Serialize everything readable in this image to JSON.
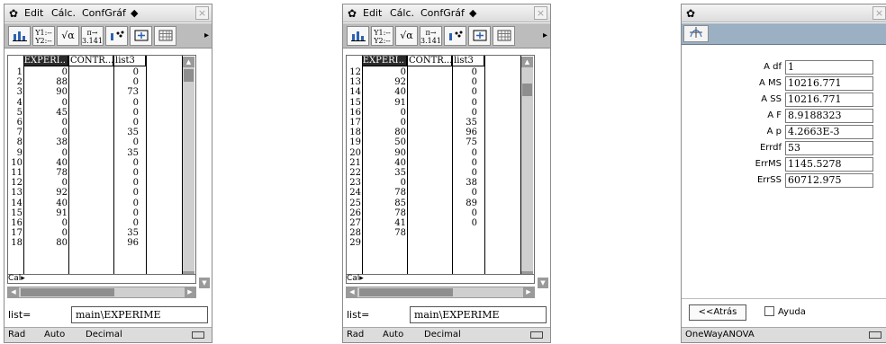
{
  "list_screens": [
    {
      "menu": {
        "items": [
          "Edit",
          "Cálc.",
          "ConfGráf",
          "◆"
        ],
        "close": "×"
      },
      "toolbar": {
        "b2": "Y1:--\nY2:--",
        "b3": "√α",
        "b4": "π→\n3.141..",
        "arrow": "▸"
      },
      "columns": [
        "EXPERI..",
        "CONTR...",
        "list3"
      ],
      "rows": [
        [
          "1",
          "0",
          "0"
        ],
        [
          "2",
          "88",
          "0"
        ],
        [
          "3",
          "90",
          "73"
        ],
        [
          "4",
          "0",
          "0"
        ],
        [
          "5",
          "45",
          "0"
        ],
        [
          "6",
          "0",
          "0"
        ],
        [
          "7",
          "0",
          "35"
        ],
        [
          "8",
          "38",
          "0"
        ],
        [
          "9",
          "0",
          "35"
        ],
        [
          "10",
          "40",
          "0"
        ],
        [
          "11",
          "78",
          "0"
        ],
        [
          "12",
          "0",
          "0"
        ],
        [
          "13",
          "92",
          "0"
        ],
        [
          "14",
          "40",
          "0"
        ],
        [
          "15",
          "91",
          "0"
        ],
        [
          "16",
          "0",
          "0"
        ],
        [
          "17",
          "0",
          "35"
        ],
        [
          "18",
          "80",
          "96"
        ]
      ],
      "cal_label": "Cal▸",
      "list_label": "list=",
      "list_value": "main\\EXPERIME",
      "status": {
        "angle": "Rad",
        "mode": "Auto",
        "format": "Decimal"
      }
    },
    {
      "menu": {
        "items": [
          "Edit",
          "Cálc.",
          "ConfGráf",
          "◆"
        ],
        "close": "×"
      },
      "toolbar": {
        "b2": "Y1:--\nY2:--",
        "b3": "√α",
        "b4": "π→\n3.141..",
        "arrow": "▸"
      },
      "columns": [
        "EXPERI..",
        "CONTR...",
        "list3"
      ],
      "rows": [
        [
          "12",
          "0",
          "0"
        ],
        [
          "13",
          "92",
          "0"
        ],
        [
          "14",
          "40",
          "0"
        ],
        [
          "15",
          "91",
          "0"
        ],
        [
          "16",
          "0",
          "0"
        ],
        [
          "17",
          "0",
          "35"
        ],
        [
          "18",
          "80",
          "96"
        ],
        [
          "19",
          "50",
          "75"
        ],
        [
          "20",
          "90",
          "0"
        ],
        [
          "21",
          "40",
          "0"
        ],
        [
          "22",
          "35",
          "0"
        ],
        [
          "23",
          "0",
          "38"
        ],
        [
          "24",
          "78",
          "0"
        ],
        [
          "25",
          "85",
          "89"
        ],
        [
          "26",
          "78",
          "0"
        ],
        [
          "27",
          "41",
          "0"
        ],
        [
          "28",
          "78",
          ""
        ],
        [
          "29",
          "",
          ""
        ]
      ],
      "cal_label": "Cal▸",
      "list_label": "list=",
      "list_value": "main\\EXPERIME",
      "status": {
        "angle": "Rad",
        "mode": "Auto",
        "format": "Decimal"
      }
    }
  ],
  "anova": {
    "results": [
      {
        "key": "A df",
        "value": "1"
      },
      {
        "key": "A MS",
        "value": "10216.771"
      },
      {
        "key": "A SS",
        "value": "10216.771"
      },
      {
        "key": "A F",
        "value": "8.9188323"
      },
      {
        "key": "A p",
        "value": "4.2663E-3"
      },
      {
        "key": "Errdf",
        "value": "53"
      },
      {
        "key": "ErrMS",
        "value": "1145.5278"
      },
      {
        "key": "ErrSS",
        "value": "60712.975"
      }
    ],
    "back_label": "<<Atrás",
    "help_label": "Ayuda",
    "status_title": "OneWayANOVA"
  }
}
